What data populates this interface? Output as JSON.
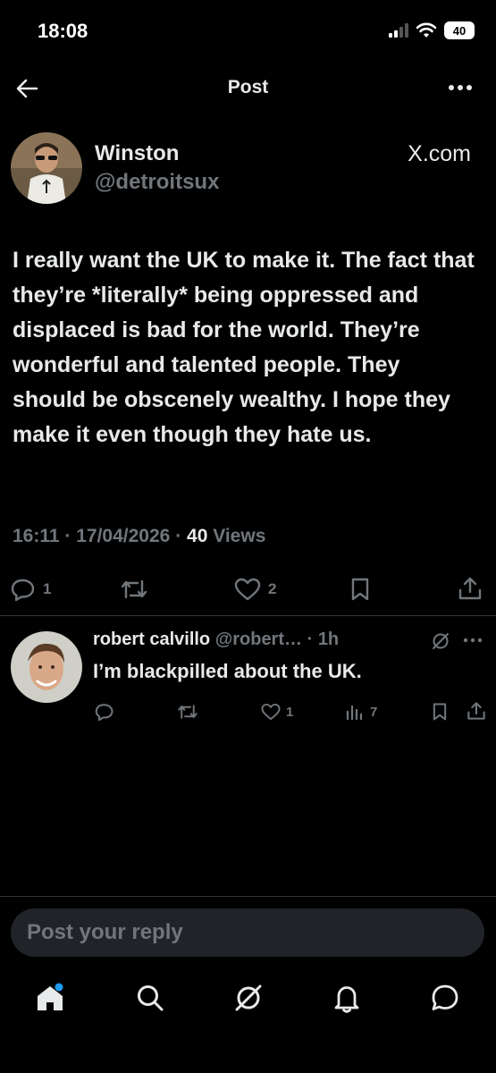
{
  "status_bar": {
    "time": "18:08",
    "battery": "40"
  },
  "header": {
    "title": "Post"
  },
  "post": {
    "author_name": "Winston",
    "author_handle": "@detroitsux",
    "source": "X.com",
    "text": "I really want the UK to make it. The fact that they’re *literally* being oppressed and displaced is bad for the world. They’re wonderful and talented people. They should be obscenely wealthy. I hope they make it even though they hate us.",
    "time": "16:11",
    "date": "17/04/2026",
    "views_count": "40",
    "views_label": "Views",
    "reply_count": "1",
    "like_count": "2"
  },
  "reply": {
    "author_name": "robert calvillo",
    "author_handle": "@robert…",
    "age": "1h",
    "text": "I’m blackpilled about the UK.",
    "like_count": "1",
    "view_count": "7"
  },
  "composer": {
    "placeholder": "Post your reply"
  },
  "colors": {
    "background": "#000000",
    "text": "#e7e9ea",
    "muted": "#71767b",
    "accent": "#1d9bf0"
  }
}
